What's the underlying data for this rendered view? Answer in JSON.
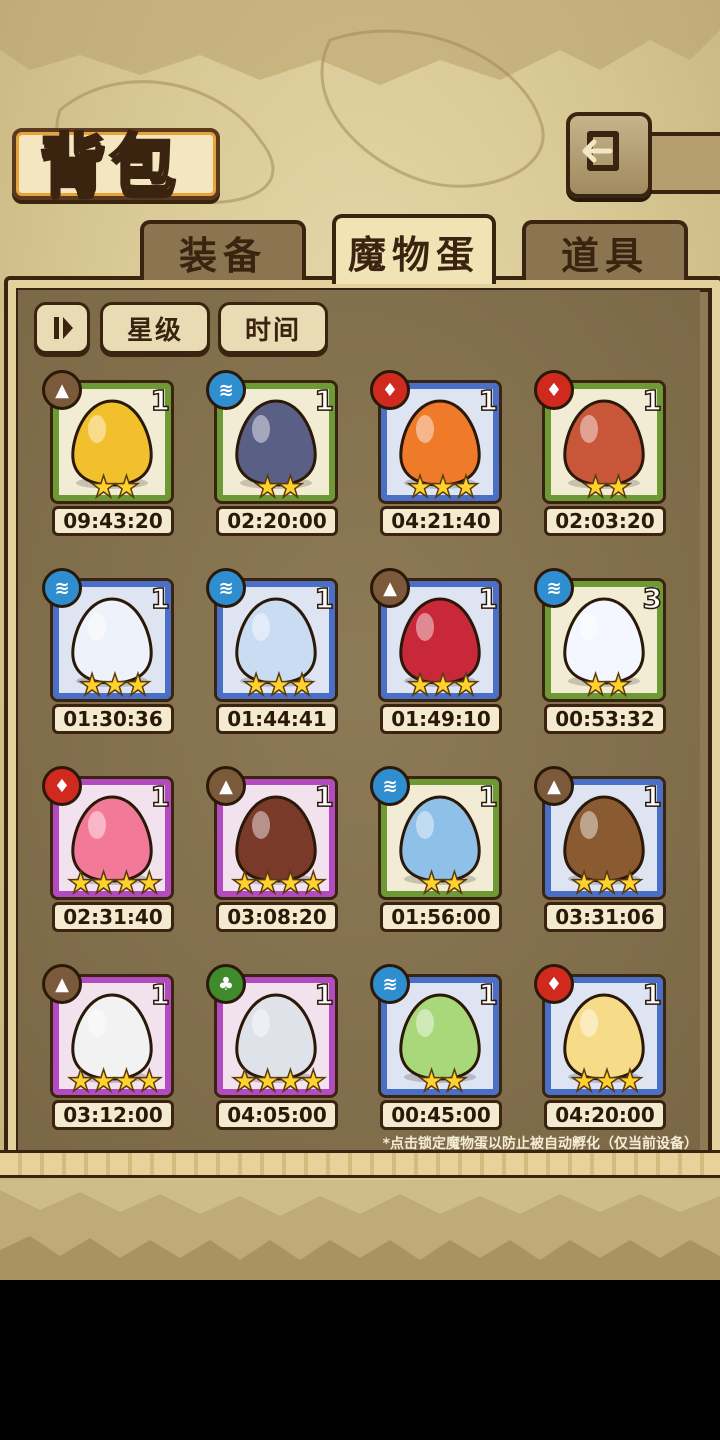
{
  "header": {
    "title": "背包"
  },
  "tabs": [
    {
      "label": "装备",
      "active": false
    },
    {
      "label": "魔物蛋",
      "active": true
    },
    {
      "label": "道具",
      "active": false
    }
  ],
  "sort": {
    "star_label": "星级",
    "time_label": "时间"
  },
  "eggs": [
    {
      "element": "earth",
      "count": "1",
      "stars": "★★",
      "time": "09:43:20",
      "rarity": "green",
      "color": "#f2c02c"
    },
    {
      "element": "water",
      "count": "1",
      "stars": "★★",
      "time": "02:20:00",
      "rarity": "green",
      "color": "#5a5f86"
    },
    {
      "element": "fire",
      "count": "1",
      "stars": "★★★",
      "time": "04:21:40",
      "rarity": "blue",
      "color": "#ee7a2a"
    },
    {
      "element": "fire",
      "count": "1",
      "stars": "★★",
      "time": "02:03:20",
      "rarity": "green",
      "color": "#c8573a"
    },
    {
      "element": "water",
      "count": "1",
      "stars": "★★★",
      "time": "01:30:36",
      "rarity": "blue",
      "color": "#eef2fa"
    },
    {
      "element": "water",
      "count": "1",
      "stars": "★★★",
      "time": "01:44:41",
      "rarity": "blue",
      "color": "#c9dcf2"
    },
    {
      "element": "earth",
      "count": "1",
      "stars": "★★★",
      "time": "01:49:10",
      "rarity": "blue",
      "color": "#c8283a"
    },
    {
      "element": "water",
      "count": "3",
      "stars": "★★",
      "time": "00:53:32",
      "rarity": "green",
      "color": "#f4f7ff"
    },
    {
      "element": "fire",
      "count": "1",
      "stars": "★★★★",
      "time": "02:31:40",
      "rarity": "purple",
      "color": "#f27a98"
    },
    {
      "element": "earth",
      "count": "1",
      "stars": "★★★★",
      "time": "03:08:20",
      "rarity": "purple",
      "color": "#7a3a2a"
    },
    {
      "element": "water",
      "count": "1",
      "stars": "★★",
      "time": "01:56:00",
      "rarity": "green",
      "color": "#8ec0e8"
    },
    {
      "element": "earth",
      "count": "1",
      "stars": "★★★",
      "time": "03:31:06",
      "rarity": "blue",
      "color": "#8a5a30"
    },
    {
      "element": "earth",
      "count": "1",
      "stars": "★★★★",
      "time": "03:12:00",
      "rarity": "purple",
      "color": "#f2f2f2"
    },
    {
      "element": "wood",
      "count": "1",
      "stars": "★★★★",
      "time": "04:05:00",
      "rarity": "purple",
      "color": "#dfe2e8"
    },
    {
      "element": "water",
      "count": "1",
      "stars": "★★",
      "time": "00:45:00",
      "rarity": "blue",
      "color": "#a8d87a"
    },
    {
      "element": "fire",
      "count": "1",
      "stars": "★★★",
      "time": "04:20:00",
      "rarity": "blue",
      "color": "#f6dc88"
    }
  ],
  "footnote": "*点击锁定魔物蛋以防止被自动孵化（仅当前设备）"
}
